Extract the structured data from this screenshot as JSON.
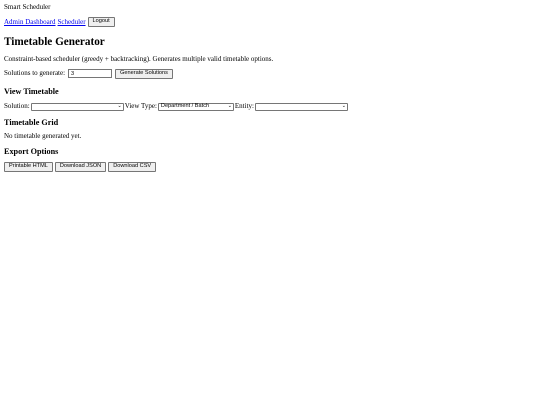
{
  "header": {
    "site_title": "Smart Scheduler"
  },
  "nav": {
    "admin_dashboard": "Admin Dashboard",
    "scheduler": "Scheduler",
    "logout": "Logout"
  },
  "main": {
    "title": "Timetable Generator",
    "description": "Constraint-based scheduler (greedy + backtracking). Generates multiple valid timetable options.",
    "solutions_label": "Solutions to generate:",
    "solutions_value": "3",
    "generate_button": "Generate Solutions"
  },
  "view": {
    "heading": "View Timetable",
    "solution_label": "Solution:",
    "solution_selected": "",
    "view_type_label": "View Type:",
    "view_type_selected": "Department / Batch",
    "entity_label": "Entity:",
    "entity_selected": ""
  },
  "grid": {
    "heading": "Timetable Grid",
    "empty_message": "No timetable generated yet."
  },
  "export": {
    "heading": "Export Options",
    "printable_html": "Printable HTML",
    "download_json": "Download JSON",
    "download_csv": "Download CSV"
  },
  "icons": {
    "dropdown": "chevron-down-icon"
  }
}
